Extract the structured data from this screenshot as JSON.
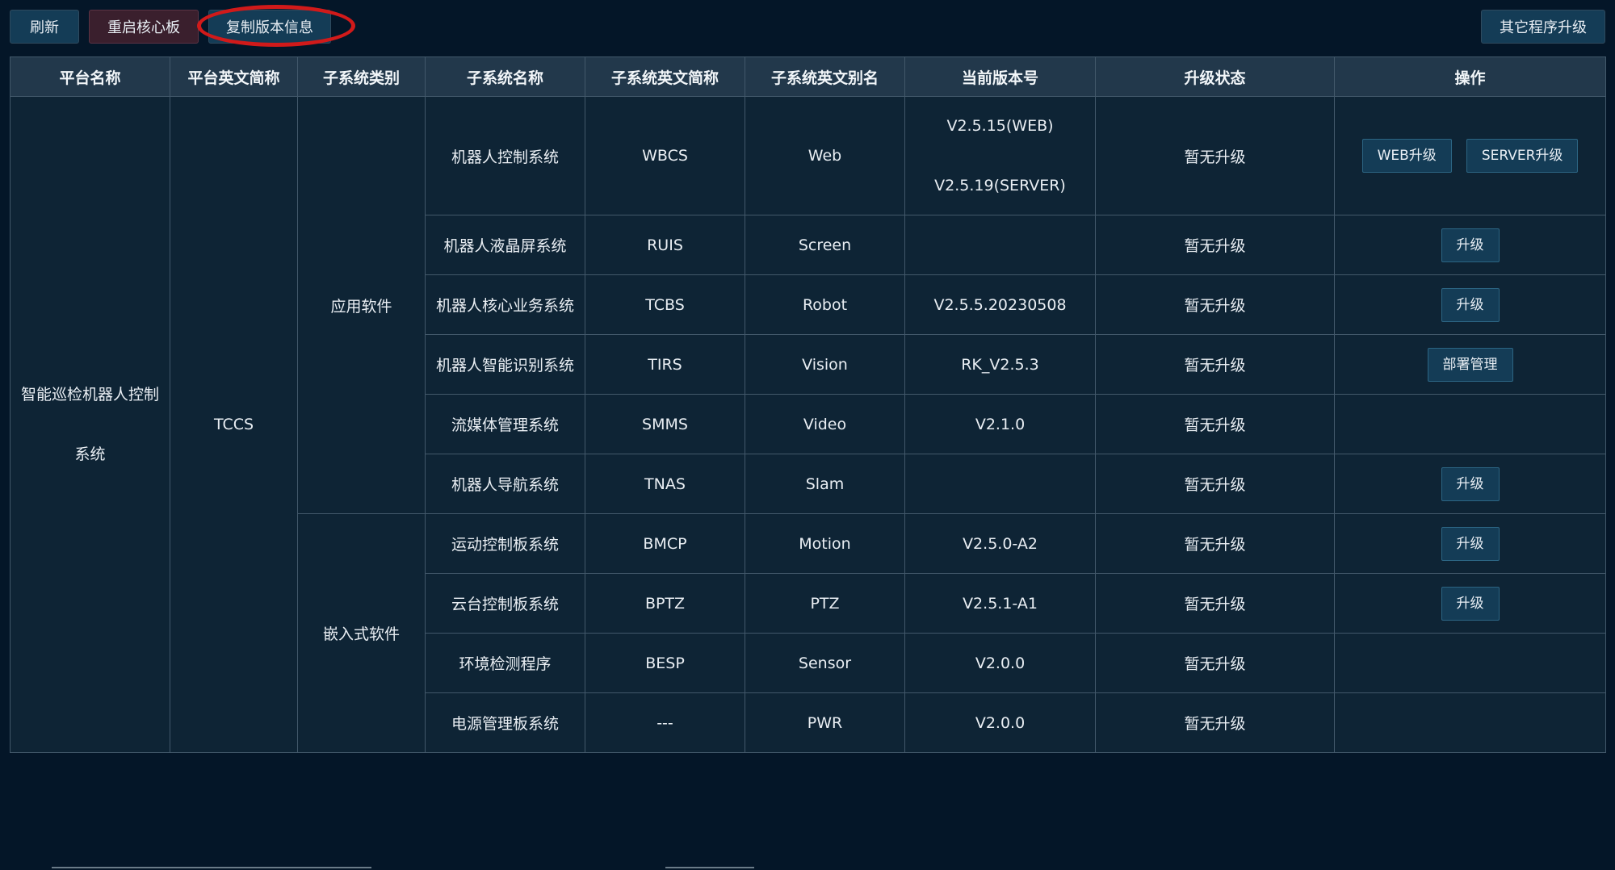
{
  "toolbar": {
    "refresh": "刷新",
    "reboot": "重启核心板",
    "copy_version": "复制版本信息",
    "other_upgrade": "其它程序升级"
  },
  "table": {
    "headers": [
      "平台名称",
      "平台英文简称",
      "子系统类别",
      "子系统名称",
      "子系统英文简称",
      "子系统英文别名",
      "当前版本号",
      "升级状态",
      "操作"
    ],
    "platform_name_line1": "智能巡检机器人控制",
    "platform_name_line2": "系统",
    "platform_abbr": "TCCS",
    "category_app": "应用软件",
    "category_embedded": "嵌入式软件",
    "rows": [
      {
        "name": "机器人控制系统",
        "abbr": "WBCS",
        "alias": "Web",
        "version_web": "V2.5.15(WEB)",
        "version_server": "V2.5.19(SERVER)",
        "status": "暂无升级",
        "btn1": "WEB升级",
        "btn2": "SERVER升级"
      },
      {
        "name": "机器人液晶屏系统",
        "abbr": "RUIS",
        "alias": "Screen",
        "version": "",
        "status": "暂无升级",
        "btn": "升级"
      },
      {
        "name": "机器人核心业务系统",
        "abbr": "TCBS",
        "alias": "Robot",
        "version": "V2.5.5.20230508",
        "status": "暂无升级",
        "btn": "升级"
      },
      {
        "name": "机器人智能识别系统",
        "abbr": "TIRS",
        "alias": "Vision",
        "version": "RK_V2.5.3",
        "status": "暂无升级",
        "btn": "部署管理"
      },
      {
        "name": "流媒体管理系统",
        "abbr": "SMMS",
        "alias": "Video",
        "version": "V2.1.0",
        "status": "暂无升级",
        "btn": ""
      },
      {
        "name": "机器人导航系统",
        "abbr": "TNAS",
        "alias": "Slam",
        "version": "",
        "status": "暂无升级",
        "btn": "升级"
      },
      {
        "name": "运动控制板系统",
        "abbr": "BMCP",
        "alias": "Motion",
        "version": "V2.5.0-A2",
        "status": "暂无升级",
        "btn": "升级"
      },
      {
        "name": "云台控制板系统",
        "abbr": "BPTZ",
        "alias": "PTZ",
        "version": "V2.5.1-A1",
        "status": "暂无升级",
        "btn": "升级"
      },
      {
        "name": "环境检测程序",
        "abbr": "BESP",
        "alias": "Sensor",
        "version": "V2.0.0",
        "status": "暂无升级",
        "btn": ""
      },
      {
        "name": "电源管理板系统",
        "abbr": "---",
        "alias": "PWR",
        "version": "V2.0.0",
        "status": "暂无升级",
        "btn": ""
      }
    ]
  },
  "colors": {
    "background": "#041628",
    "header_bg": "#22384b",
    "cell_bg": "#0e2435",
    "button_bg": "#143c56",
    "highlight": "#d11a1a"
  }
}
